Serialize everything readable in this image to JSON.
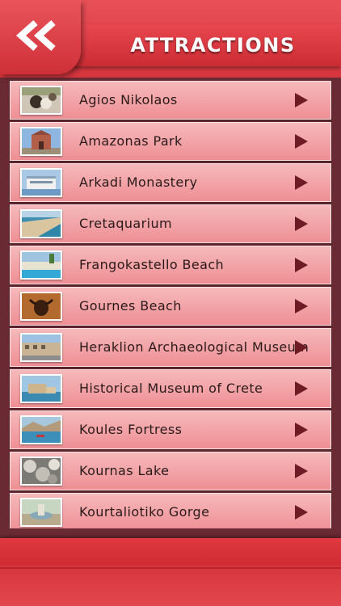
{
  "header": {
    "title": "ATTRACTIONS",
    "back_icon": "double-chevron-left-icon",
    "colors": {
      "primary": "#d7353d",
      "row": "#f3a7aa",
      "arrow": "#6e1b26",
      "background": "#6a2a33"
    }
  },
  "attractions": [
    {
      "name": "Agios Nikolaos"
    },
    {
      "name": "Amazonas Park"
    },
    {
      "name": "Arkadi Monastery"
    },
    {
      "name": "Cretaquarium"
    },
    {
      "name": "Frangokastello Beach"
    },
    {
      "name": "Gournes Beach"
    },
    {
      "name": "Heraklion Archaeological Museum"
    },
    {
      "name": "Historical Museum of Crete"
    },
    {
      "name": "Koules Fortress"
    },
    {
      "name": "Kournas Lake"
    },
    {
      "name": "Kourtaliotiko Gorge"
    }
  ]
}
